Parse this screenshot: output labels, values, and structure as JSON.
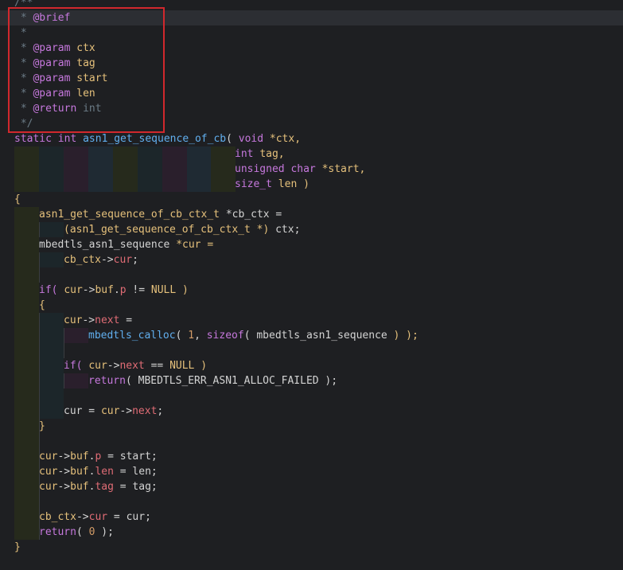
{
  "colors": {
    "background": "#1e1f22",
    "comment": "#6b7b86",
    "doc_tag": "#c678dd",
    "keyword": "#c678dd",
    "type": "#c678dd",
    "function": "#61afef",
    "param": "#e5c07b",
    "field": "#e06c75",
    "number": "#d19a66",
    "plain": "#d4d4d4",
    "annotation_box": "#d1282d"
  },
  "lines": [
    [
      {
        "t": "/**",
        "c": "comment"
      }
    ],
    [
      {
        "t": " * ",
        "c": "comment"
      },
      {
        "t": "@brief",
        "c": "doc_tag"
      }
    ],
    [
      {
        "t": " *",
        "c": "comment"
      }
    ],
    [
      {
        "t": " * ",
        "c": "comment"
      },
      {
        "t": "@param",
        "c": "doc_tag"
      },
      {
        "t": " ctx",
        "c": "param"
      }
    ],
    [
      {
        "t": " * ",
        "c": "comment"
      },
      {
        "t": "@param",
        "c": "doc_tag"
      },
      {
        "t": " tag",
        "c": "param"
      }
    ],
    [
      {
        "t": " * ",
        "c": "comment"
      },
      {
        "t": "@param",
        "c": "doc_tag"
      },
      {
        "t": " start",
        "c": "param"
      }
    ],
    [
      {
        "t": " * ",
        "c": "comment"
      },
      {
        "t": "@param",
        "c": "doc_tag"
      },
      {
        "t": " len",
        "c": "param"
      }
    ],
    [
      {
        "t": " * ",
        "c": "comment"
      },
      {
        "t": "@return",
        "c": "doc_tag"
      },
      {
        "t": " int",
        "c": "comment"
      }
    ],
    [
      {
        "t": " */",
        "c": "comment"
      }
    ],
    [
      {
        "t": "static int ",
        "c": "keyword"
      },
      {
        "t": "asn1_get_sequence_of_cb",
        "c": "function"
      },
      {
        "t": "( ",
        "c": "plain"
      },
      {
        "t": "void ",
        "c": "type"
      },
      {
        "t": "*ctx,",
        "c": "param"
      }
    ],
    [
      {
        "t": "int ",
        "c": "type"
      },
      {
        "t": "tag,",
        "c": "param"
      }
    ],
    [
      {
        "t": "unsigned char ",
        "c": "type"
      },
      {
        "t": "*start,",
        "c": "param"
      }
    ],
    [
      {
        "t": "size_t ",
        "c": "type"
      },
      {
        "t": "len )",
        "c": "param"
      }
    ],
    [
      {
        "t": "{",
        "c": "param"
      }
    ],
    [
      {
        "t": "asn1_get_sequence_of_cb_ctx_t ",
        "c": "param"
      },
      {
        "t": "*cb_ctx =",
        "c": "plain"
      }
    ],
    [
      {
        "t": "(asn1_get_sequence_of_cb_ctx_t *) ",
        "c": "param"
      },
      {
        "t": "ctx;",
        "c": "plain"
      }
    ],
    [
      {
        "t": "mbedtls_asn1_sequence ",
        "c": "plain"
      },
      {
        "t": "*cur =",
        "c": "param"
      }
    ],
    [
      {
        "t": "cb_ctx",
        "c": "param"
      },
      {
        "t": "->",
        "c": "plain"
      },
      {
        "t": "cur",
        "c": "field"
      },
      {
        "t": ";",
        "c": "plain"
      }
    ],
    [],
    [
      {
        "t": "if( ",
        "c": "keyword"
      },
      {
        "t": "cur",
        "c": "param"
      },
      {
        "t": "->",
        "c": "plain"
      },
      {
        "t": "buf",
        "c": "param"
      },
      {
        "t": ".",
        "c": "plain"
      },
      {
        "t": "p",
        "c": "field"
      },
      {
        "t": " != ",
        "c": "plain"
      },
      {
        "t": "NULL )",
        "c": "param"
      }
    ],
    [
      {
        "t": "{",
        "c": "param"
      }
    ],
    [
      {
        "t": "cur",
        "c": "param"
      },
      {
        "t": "->",
        "c": "plain"
      },
      {
        "t": "next",
        "c": "field"
      },
      {
        "t": " =",
        "c": "plain"
      }
    ],
    [
      {
        "t": "mbedtls_calloc",
        "c": "function"
      },
      {
        "t": "( ",
        "c": "plain"
      },
      {
        "t": "1",
        "c": "number"
      },
      {
        "t": ", ",
        "c": "plain"
      },
      {
        "t": "sizeof",
        "c": "keyword"
      },
      {
        "t": "( mbedtls_asn1_sequence ",
        "c": "plain"
      },
      {
        "t": ") );",
        "c": "param"
      }
    ],
    [],
    [
      {
        "t": "if( ",
        "c": "keyword"
      },
      {
        "t": "cur",
        "c": "param"
      },
      {
        "t": "->",
        "c": "plain"
      },
      {
        "t": "next",
        "c": "field"
      },
      {
        "t": " == ",
        "c": "plain"
      },
      {
        "t": "NULL )",
        "c": "param"
      }
    ],
    [
      {
        "t": "return",
        "c": "keyword"
      },
      {
        "t": "( MBEDTLS_ERR_ASN1_ALLOC_FAILED );",
        "c": "plain"
      }
    ],
    [],
    [
      {
        "t": "cur = ",
        "c": "plain"
      },
      {
        "t": "cur",
        "c": "param"
      },
      {
        "t": "->",
        "c": "plain"
      },
      {
        "t": "next",
        "c": "field"
      },
      {
        "t": ";",
        "c": "plain"
      }
    ],
    [
      {
        "t": "}",
        "c": "param"
      }
    ],
    [],
    [
      {
        "t": "cur",
        "c": "param"
      },
      {
        "t": "->",
        "c": "plain"
      },
      {
        "t": "buf",
        "c": "param"
      },
      {
        "t": ".",
        "c": "plain"
      },
      {
        "t": "p",
        "c": "field"
      },
      {
        "t": " = start;",
        "c": "plain"
      }
    ],
    [
      {
        "t": "cur",
        "c": "param"
      },
      {
        "t": "->",
        "c": "plain"
      },
      {
        "t": "buf",
        "c": "param"
      },
      {
        "t": ".",
        "c": "plain"
      },
      {
        "t": "len",
        "c": "field"
      },
      {
        "t": " = len;",
        "c": "plain"
      }
    ],
    [
      {
        "t": "cur",
        "c": "param"
      },
      {
        "t": "->",
        "c": "plain"
      },
      {
        "t": "buf",
        "c": "param"
      },
      {
        "t": ".",
        "c": "plain"
      },
      {
        "t": "tag",
        "c": "field"
      },
      {
        "t": " = tag;",
        "c": "plain"
      }
    ],
    [],
    [
      {
        "t": "cb_ctx",
        "c": "param"
      },
      {
        "t": "->",
        "c": "plain"
      },
      {
        "t": "cur",
        "c": "field"
      },
      {
        "t": " = cur;",
        "c": "plain"
      }
    ],
    [
      {
        "t": "return",
        "c": "keyword"
      },
      {
        "t": "( ",
        "c": "plain"
      },
      {
        "t": "0",
        "c": "number"
      },
      {
        "t": " );",
        "c": "plain"
      }
    ],
    [
      {
        "t": "}",
        "c": "param"
      }
    ]
  ]
}
